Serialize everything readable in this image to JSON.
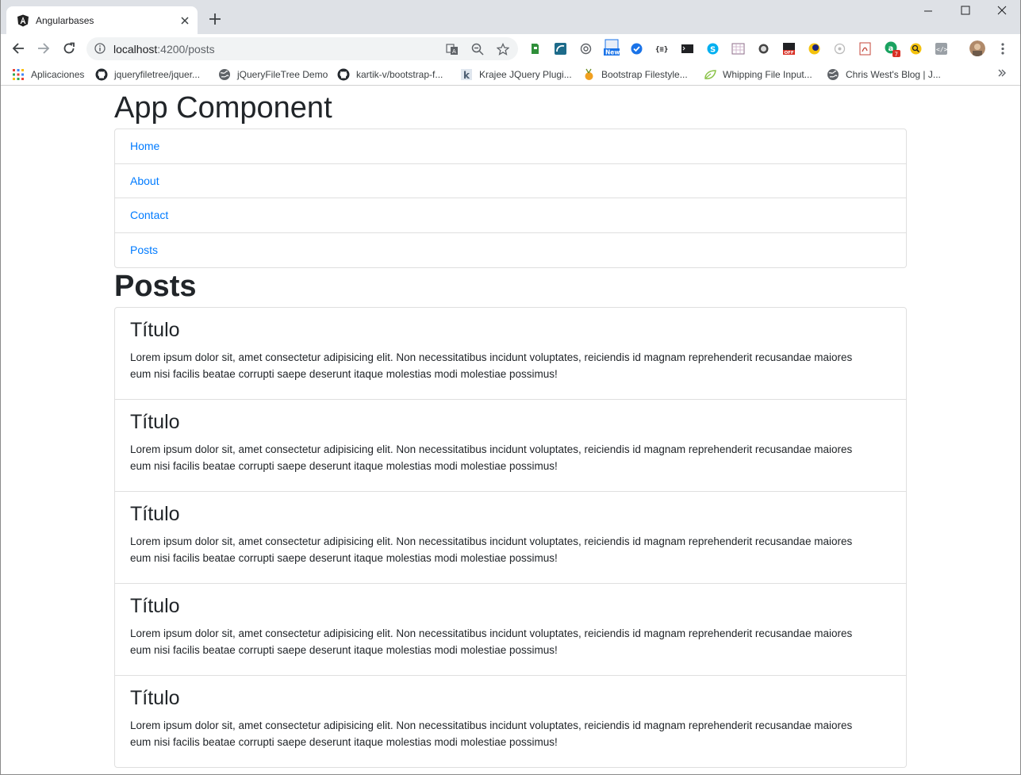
{
  "browser": {
    "tab_title": "Angularbases",
    "url_host": "localhost",
    "url_path": ":4200/posts",
    "bookmarks": [
      {
        "label": "Aplicaciones",
        "icon": "apps-grid-icon"
      },
      {
        "label": "jqueryfiletree/jquer...",
        "icon": "github-icon"
      },
      {
        "label": "jQueryFileTree Demo",
        "icon": "globe-icon"
      },
      {
        "label": "kartik-v/bootstrap-f...",
        "icon": "github-icon"
      },
      {
        "label": "Krajee JQuery Plugi...",
        "icon": "krajee-icon"
      },
      {
        "label": "Bootstrap Filestyle...",
        "icon": "bootstrap-filestyle-icon"
      },
      {
        "label": "Whipping File Input...",
        "icon": "leaf-icon"
      },
      {
        "label": "Chris West's Blog | J...",
        "icon": "globe-icon"
      }
    ]
  },
  "app": {
    "title": "App Component",
    "nav": [
      {
        "label": "Home"
      },
      {
        "label": "About"
      },
      {
        "label": "Contact"
      },
      {
        "label": "Posts"
      }
    ],
    "section_title": "Posts",
    "posts": [
      {
        "title": "Título",
        "body": "Lorem ipsum dolor sit, amet consectetur adipisicing elit. Non necessitatibus incidunt voluptates, reiciendis id magnam reprehenderit recusandae maiores eum nisi facilis beatae corrupti saepe deserunt itaque molestias modi molestiae possimus!"
      },
      {
        "title": "Título",
        "body": "Lorem ipsum dolor sit, amet consectetur adipisicing elit. Non necessitatibus incidunt voluptates, reiciendis id magnam reprehenderit recusandae maiores eum nisi facilis beatae corrupti saepe deserunt itaque molestias modi molestiae possimus!"
      },
      {
        "title": "Título",
        "body": "Lorem ipsum dolor sit, amet consectetur adipisicing elit. Non necessitatibus incidunt voluptates, reiciendis id magnam reprehenderit recusandae maiores eum nisi facilis beatae corrupti saepe deserunt itaque molestias modi molestiae possimus!"
      },
      {
        "title": "Título",
        "body": "Lorem ipsum dolor sit, amet consectetur adipisicing elit. Non necessitatibus incidunt voluptates, reiciendis id magnam reprehenderit recusandae maiores eum nisi facilis beatae corrupti saepe deserunt itaque molestias modi molestiae possimus!"
      },
      {
        "title": "Título",
        "body": "Lorem ipsum dolor sit, amet consectetur adipisicing elit. Non necessitatibus incidunt voluptates, reiciendis id magnam reprehenderit recusandae maiores eum nisi facilis beatae corrupti saepe deserunt itaque molestias modi molestiae possimus!"
      }
    ]
  },
  "colors": {
    "link": "#007bff",
    "chrome_frame": "#dee1e6",
    "border": "#dfdfdf",
    "text": "#212529"
  }
}
